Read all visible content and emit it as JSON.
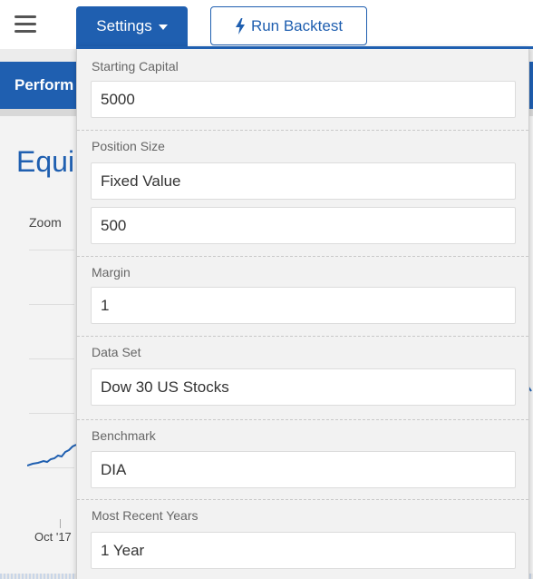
{
  "toolbar": {
    "menu_icon": "hamburger-icon",
    "settings_label": "Settings",
    "run_label": "Run Backtest",
    "run_icon": "lightning-icon"
  },
  "background": {
    "tab_label": "Perform",
    "section_title": "Equi",
    "zoom_label": "Zoom",
    "x_axis_label": "Oct '17"
  },
  "settings_panel": {
    "starting_capital": {
      "label": "Starting Capital",
      "value": "5000"
    },
    "position_size": {
      "label": "Position Size",
      "mode": "Fixed Value",
      "value": "500"
    },
    "margin": {
      "label": "Margin",
      "value": "1"
    },
    "data_set": {
      "label": "Data Set",
      "value": "Dow 30 US Stocks"
    },
    "benchmark": {
      "label": "Benchmark",
      "value": "DIA"
    },
    "most_recent_years": {
      "label": "Most Recent Years",
      "value": "1 Year"
    }
  },
  "colors": {
    "primary": "#1f5fb0",
    "panel_bg": "#f2f2f2",
    "field_bg": "#ffffff"
  }
}
